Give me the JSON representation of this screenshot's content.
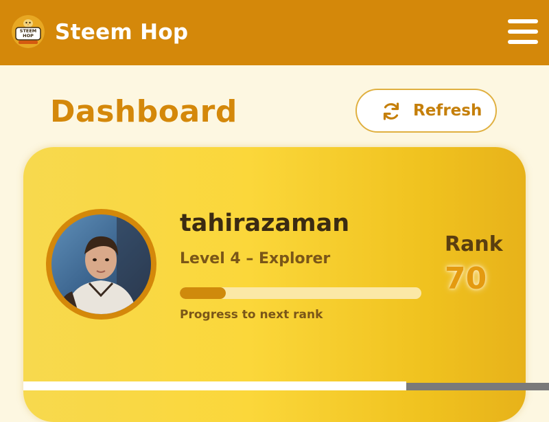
{
  "header": {
    "app_title": "Steem Hop",
    "logo_text": "STEEM HOP",
    "logo_icon": "chick-mascot-logo",
    "menu_icon": "hamburger-menu-icon",
    "background_color": "#d4880a"
  },
  "page": {
    "title": "Dashboard",
    "refresh_label": "Refresh",
    "refresh_icon": "refresh-icon"
  },
  "profile": {
    "username": "tahirazaman",
    "level_text": "Level 4 – Explorer",
    "progress_fraction": 0.19,
    "progress_label": "Progress to next rank",
    "rank_label": "Rank",
    "rank_value": "70",
    "avatar": "user-avatar-photo"
  },
  "colors": {
    "accent": "#d4880a",
    "card_gradient_start": "#f7d94e",
    "card_gradient_end": "#e7b21a",
    "background": "#fdf7e1"
  }
}
